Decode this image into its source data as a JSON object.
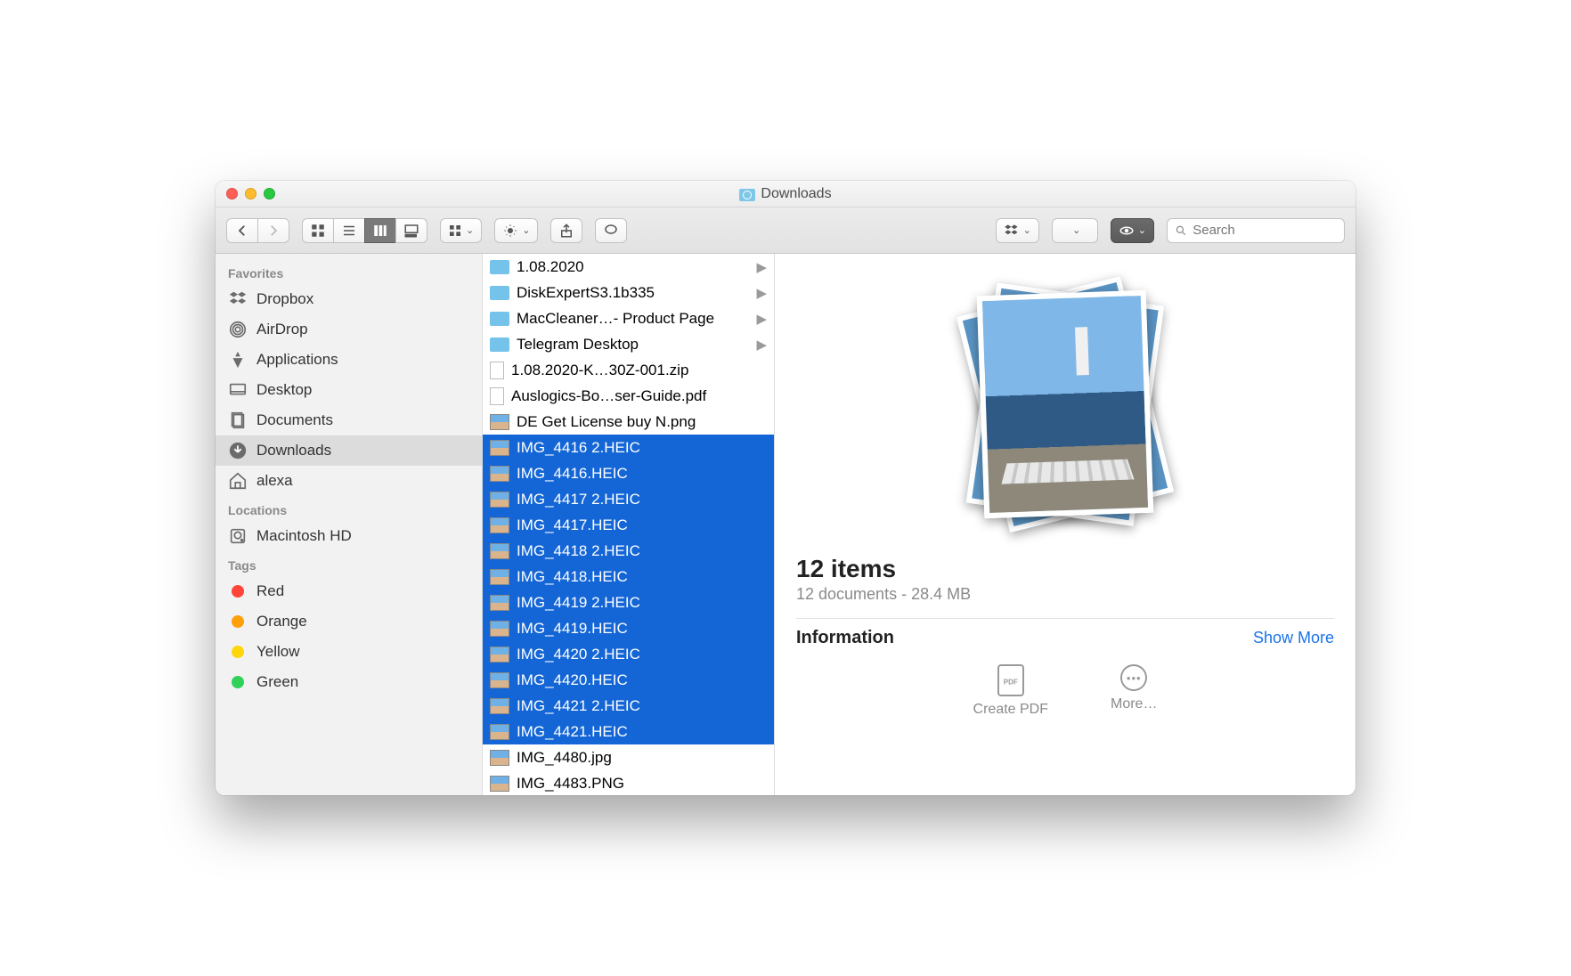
{
  "window": {
    "title": "Downloads"
  },
  "toolbar": {
    "search_placeholder": "Search"
  },
  "sidebar": {
    "sections": [
      {
        "header": "Favorites",
        "items": [
          {
            "label": "Dropbox",
            "icon": "dropbox"
          },
          {
            "label": "AirDrop",
            "icon": "airdrop"
          },
          {
            "label": "Applications",
            "icon": "applications"
          },
          {
            "label": "Desktop",
            "icon": "desktop"
          },
          {
            "label": "Documents",
            "icon": "documents"
          },
          {
            "label": "Downloads",
            "icon": "downloads",
            "active": true
          },
          {
            "label": "alexa",
            "icon": "home"
          }
        ]
      },
      {
        "header": "Locations",
        "items": [
          {
            "label": "Macintosh HD",
            "icon": "hdd"
          }
        ]
      },
      {
        "header": "Tags",
        "items": [
          {
            "label": "Red",
            "tag": "red"
          },
          {
            "label": "Orange",
            "tag": "orange"
          },
          {
            "label": "Yellow",
            "tag": "yellow"
          },
          {
            "label": "Green",
            "tag": "green"
          }
        ]
      }
    ]
  },
  "files": [
    {
      "name": "1.08.2020",
      "type": "folder"
    },
    {
      "name": "DiskExpertS3.1b335",
      "type": "folder"
    },
    {
      "name": "MacCleaner…- Product Page",
      "type": "folder"
    },
    {
      "name": "Telegram Desktop",
      "type": "folder"
    },
    {
      "name": "1.08.2020-K…30Z-001.zip",
      "type": "file"
    },
    {
      "name": "Auslogics-Bo…ser-Guide.pdf",
      "type": "file"
    },
    {
      "name": "DE Get License buy N.png",
      "type": "img"
    },
    {
      "name": "IMG_4416 2.HEIC",
      "type": "img",
      "selected": true
    },
    {
      "name": "IMG_4416.HEIC",
      "type": "img",
      "selected": true
    },
    {
      "name": "IMG_4417 2.HEIC",
      "type": "img",
      "selected": true
    },
    {
      "name": "IMG_4417.HEIC",
      "type": "img",
      "selected": true
    },
    {
      "name": "IMG_4418 2.HEIC",
      "type": "img",
      "selected": true
    },
    {
      "name": "IMG_4418.HEIC",
      "type": "img",
      "selected": true
    },
    {
      "name": "IMG_4419 2.HEIC",
      "type": "img",
      "selected": true
    },
    {
      "name": "IMG_4419.HEIC",
      "type": "img",
      "selected": true
    },
    {
      "name": "IMG_4420 2.HEIC",
      "type": "img",
      "selected": true
    },
    {
      "name": "IMG_4420.HEIC",
      "type": "img",
      "selected": true
    },
    {
      "name": "IMG_4421 2.HEIC",
      "type": "img",
      "selected": true
    },
    {
      "name": "IMG_4421.HEIC",
      "type": "img",
      "selected": true
    },
    {
      "name": "IMG_4480.jpg",
      "type": "img"
    },
    {
      "name": "IMG_4483.PNG",
      "type": "img"
    }
  ],
  "preview": {
    "count_label": "12 items",
    "subtitle": "12 documents - 28.4 MB",
    "info_header": "Information",
    "show_more": "Show More",
    "actions": {
      "create_pdf": "Create PDF",
      "more": "More…"
    }
  }
}
